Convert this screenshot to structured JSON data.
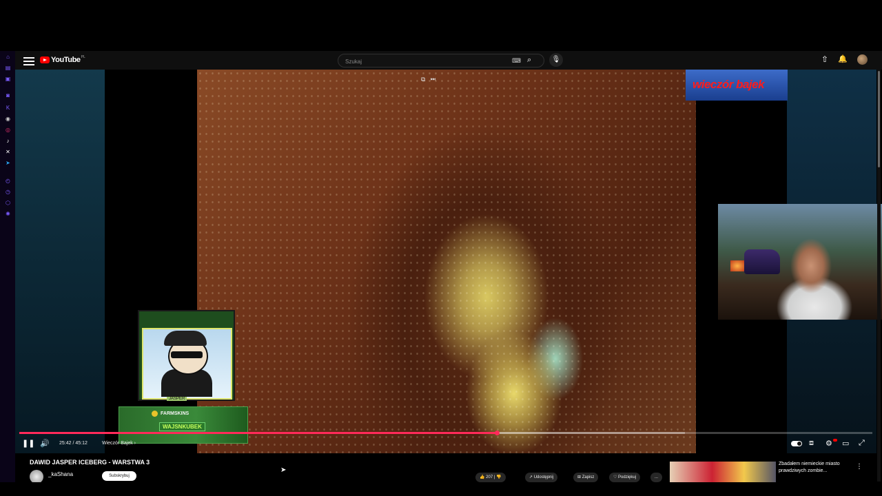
{
  "masthead": {
    "logo_text": "YouTube",
    "country_code": "PL",
    "search_placeholder": "Szukaj",
    "keyboard_icon": "keyboard-icon",
    "search_icon": "search-icon",
    "mic_icon": "mic-icon",
    "upload_icon": "upload-icon",
    "bell_icon": "bell-icon"
  },
  "left_rail": {
    "icons": [
      "home-icon",
      "subscriptions-icon",
      "library-icon",
      "twitch-icon",
      "kick-icon",
      "discord-icon",
      "instagram-icon",
      "tiktok-icon",
      "x-icon",
      "telegram-icon",
      "history-icon",
      "clock-icon",
      "tag-icon",
      "settings-icon"
    ]
  },
  "overlay": {
    "channel_tag": "wieczór bajek",
    "farm_label": "FARMSKINS",
    "farm_code": "WAJSNKUBEK",
    "card_name": "JASPER"
  },
  "player": {
    "time": "25:42 / 45:12",
    "chapter": "Wieczór Bajek",
    "progress": 0.56,
    "buffered": 0.78
  },
  "video": {
    "title": "DAWID JASPER ICEBERG - WARSTWA 3",
    "channel": "_kaShana",
    "subscribe": "Subskrybuj",
    "likes": "207",
    "share": "Udostępnij",
    "save": "Zapisz",
    "clip": "Podziękuj",
    "more": "..."
  },
  "recommendation": {
    "title": "Zbadałem niemieckie miasto prawdziwych zombie..."
  },
  "colors": {
    "progress": "#ff2a5a",
    "brand": "#ff0000",
    "rail_accent": "#7b5cff"
  }
}
